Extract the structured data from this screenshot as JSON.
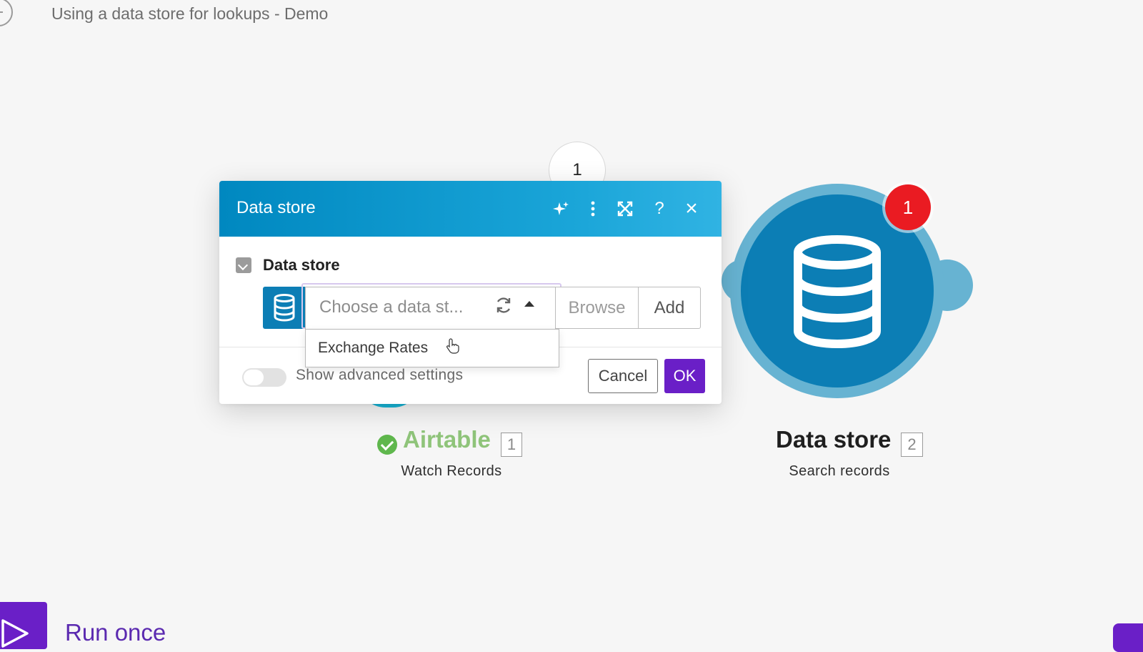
{
  "scenario": {
    "title": "Using a data store for lookups - Demo"
  },
  "route": {
    "bubble_label": "1"
  },
  "modules": {
    "airtable": {
      "name": "Airtable",
      "number": "1",
      "action": "Watch Records",
      "status_color": "#5fb74d",
      "name_color": "#8fc47a"
    },
    "datastore": {
      "name": "Data store",
      "number": "2",
      "action": "Search records",
      "badge": "1",
      "color": "#0c7eb5"
    }
  },
  "dialog": {
    "title": "Data store",
    "header_icons": [
      "ai-sparkle-icon",
      "more-vertical-icon",
      "expand-icon",
      "help-icon",
      "close-icon"
    ],
    "header_help": "?",
    "header_close": "×",
    "field": {
      "label": "Data store",
      "placeholder": "Choose a data st...",
      "browse_label": "Browse",
      "add_label": "Add",
      "options": [
        "Exchange Rates"
      ]
    },
    "advanced_toggle_label": "Show advanced settings",
    "cancel_label": "Cancel",
    "ok_label": "OK"
  },
  "footer": {
    "run_once_label": "Run once"
  },
  "colors": {
    "accent": "#6a1fc7",
    "header": "#0088c0",
    "badge": "#ea1b22"
  }
}
